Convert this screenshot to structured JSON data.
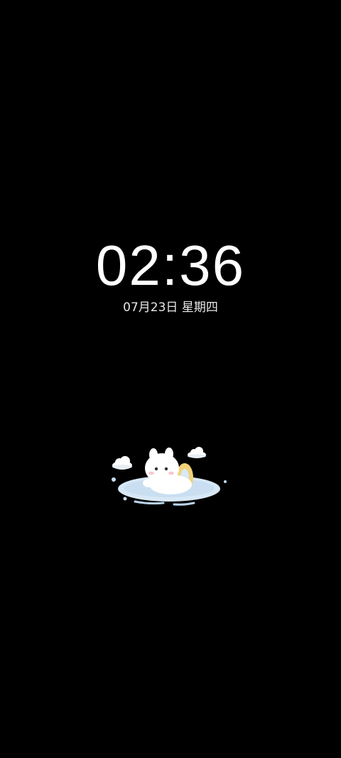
{
  "lockscreen": {
    "time": "02:36",
    "date": "07月23日",
    "weekday": "星期四"
  },
  "colors": {
    "background": "#000000",
    "text": "#ffffff",
    "puddle": "#cfe3f4",
    "float_ring": "#f1d27a"
  },
  "illustration": {
    "icon": "bunny-in-puddle-icon"
  }
}
